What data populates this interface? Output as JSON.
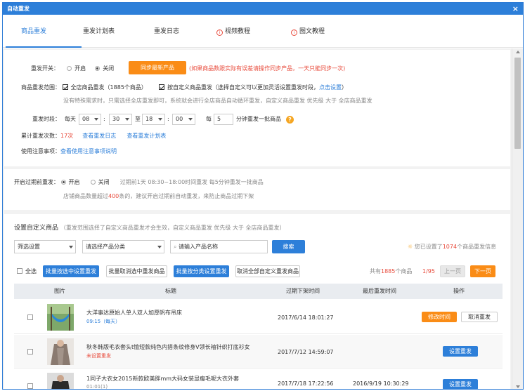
{
  "window": {
    "title": "自动重发"
  },
  "tabs": [
    {
      "label": "商品重发"
    },
    {
      "label": "重发计划表"
    },
    {
      "label": "重发日志"
    },
    {
      "label": "视频教程"
    },
    {
      "label": "图文教程"
    }
  ],
  "settings": {
    "switch_label": "重发开关：",
    "on": "开启",
    "off": "关闭",
    "sync_button": "同步最新产品",
    "sync_note": "(如果商品数跟实际有误差请操作同步产品，一天只能同步一次)",
    "scope_label": "商品重发范围：",
    "scope_all": "全店商品重发（1885个商品）",
    "scope_custom": "按自定义商品重发（选择自定义可以更加灵活设置重发时段，",
    "scope_link": "点击设置",
    "scope_close": "）",
    "scope_hint": "没有特殊需求时，只需选择全店重发即可，系统就会进行全店商品自动循环重发，自定义商品重发 优先级 大于 全店商品重发",
    "period_label": "重发时段：",
    "everyday": "每天",
    "start_hour": "08",
    "start_min": "30",
    "to": "至",
    "end_hour": "18",
    "end_min": "00",
    "every": "每",
    "interval": "5",
    "interval_suffix": "分钟重发一批商品",
    "count_label": "累计重发次数：",
    "count_value": "17次",
    "log_link": "查看重发日志",
    "plan_link": "查看重发计划表",
    "notice_label": "使用注意事项：",
    "notice_link": "查看使用注意事项说明"
  },
  "expire": {
    "label": "开启过期前重发：",
    "on": "开启",
    "off": "关闭",
    "desc": "过期前1天 08:30~18:00时间重发 每5分钟重发一批商品",
    "hint_pre": "店铺商品数量超过",
    "hint_num": "400",
    "hint_post": "条的，建议开启过期前自动重发，来防止商品过期下架"
  },
  "custom": {
    "title": "设置自定义商品",
    "title_note": "（重发范围选择了自定义商品重发才会生效，自定义商品重发 优先级 大于 全店商品重发）",
    "filter_placeholder": "筛选设置",
    "category_placeholder": "请选择产品分类",
    "name_placeholder": "请输入产品名称",
    "search_button": "搜索",
    "info_pre": "您已设置了",
    "info_num": "1074",
    "info_post": "个商品重发信息",
    "select_all": "全选",
    "btn_batch_set": "批量按选中设置重发",
    "btn_batch_cancel": "批量取消选中重发商品",
    "btn_category": "批量按分类设置重发",
    "btn_cancel_all": "取消全部自定义重发商品",
    "total_pre": "共有",
    "total_num": "1885",
    "total_post": "个商品",
    "page": "1/95",
    "prev": "上一页",
    "next": "下一页"
  },
  "table": {
    "headers": [
      "图片",
      "标题",
      "过期下架时间",
      "最后重发时间",
      "操作"
    ],
    "rows": [
      {
        "title": "大洋事达原始人单人双人加厚帆布吊床",
        "sub": "09:15（每天）",
        "expire": "2017/6/14 18:01:27",
        "last": "",
        "btn1": "修改时间",
        "btn2": "取消重发"
      },
      {
        "title": "秋冬韩版毛衣套头t恤短款纯色内搭条纹修身V领长袖针织打底衫女",
        "sub": "未设置重发",
        "expire": "2017/7/12 14:59:07",
        "last": "",
        "btn1": "设置重发"
      },
      {
        "title": "1同子大衣女2015新款欧美胖mm大码女装显瘦毛呢大衣外套",
        "sub": "01:01(1)",
        "expire": "2017/7/18 17:22:56",
        "last": "2016/9/19 10:30:29",
        "btn1": "设置重发"
      }
    ]
  },
  "colors": {
    "accent": "#2d7fd9",
    "orange": "#fa8c16",
    "red": "#e84c3d"
  }
}
